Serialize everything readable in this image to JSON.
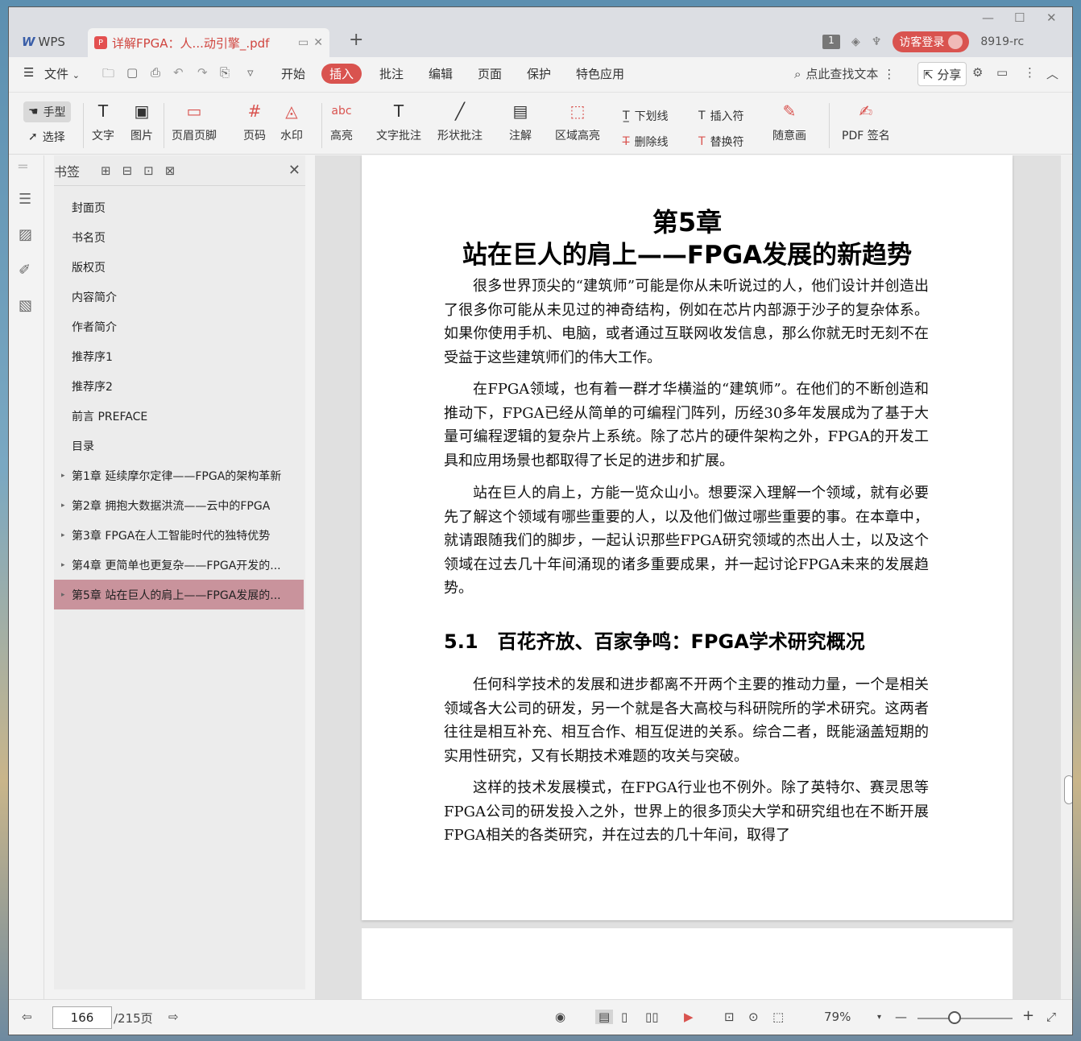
{
  "window": {
    "app_tab": "WPS",
    "doc_tab": "详解FPGA：人...动引擎_.pdf",
    "new_tab_symbol": "+",
    "page_badge": "1",
    "login_label": "访客登录",
    "version": "8919-rc",
    "controls": {
      "minimize": "—",
      "maximize": "☐",
      "close": "✕"
    }
  },
  "menu": {
    "file": "文件",
    "items": [
      "开始",
      "插入",
      "批注",
      "编辑",
      "页面",
      "保护",
      "特色应用"
    ],
    "active": "插入",
    "search": "点此查找文本",
    "share": "分享"
  },
  "toolbar": {
    "hand": "手型",
    "select": "选择",
    "text": "文字",
    "image": "图片",
    "header_footer": "页眉页脚",
    "page_number": "页码",
    "watermark": "水印",
    "highlight": "高亮",
    "text_comment": "文字批注",
    "shape_comment": "形状批注",
    "annotation": "注解",
    "area_highlight": "区域高亮",
    "underline": "下划线",
    "strikethrough": "删除线",
    "insert_mark": "插入符",
    "replace_mark": "替换符",
    "freehand": "随意画",
    "pdf_sign": "PDF 签名"
  },
  "bookmarks": {
    "title": "书签",
    "items": [
      {
        "label": "封面页",
        "expandable": false
      },
      {
        "label": "书名页",
        "expandable": false
      },
      {
        "label": "版权页",
        "expandable": false
      },
      {
        "label": "内容简介",
        "expandable": false
      },
      {
        "label": "作者简介",
        "expandable": false
      },
      {
        "label": "推荐序1",
        "expandable": false
      },
      {
        "label": "推荐序2",
        "expandable": false
      },
      {
        "label": "前言 PREFACE",
        "expandable": false
      },
      {
        "label": "目录",
        "expandable": false
      },
      {
        "label": "第1章 延续摩尔定律——FPGA的架构革新",
        "expandable": true
      },
      {
        "label": "第2章 拥抱大数据洪流——云中的FPGA",
        "expandable": true
      },
      {
        "label": "第3章 FPGA在人工智能时代的独特优势",
        "expandable": true
      },
      {
        "label": "第4章 更简单也更复杂——FPGA开发的...",
        "expandable": true
      },
      {
        "label": "第5章 站在巨人的肩上——FPGA发展的...",
        "expandable": true,
        "selected": true
      }
    ]
  },
  "document": {
    "chapter_number": "第5章",
    "chapter_title": "站在巨人的肩上——FPGA发展的新趋势",
    "paragraphs": [
      "很多世界顶尖的“建筑师”可能是你从未听说过的人，他们设计并创造出了很多你可能从未见过的神奇结构，例如在芯片内部源于沙子的复杂体系。如果你使用手机、电脑，或者通过互联网收发信息，那么你就无时无刻不在受益于这些建筑师们的伟大工作。",
      "在FPGA领域，也有着一群才华横溢的“建筑师”。在他们的不断创造和推动下，FPGA已经从简单的可编程门阵列，历经30多年发展成为了基于大量可编程逻辑的复杂片上系统。除了芯片的硬件架构之外，FPGA的开发工具和应用场景也都取得了长足的进步和扩展。",
      "站在巨人的肩上，方能一览众山小。想要深入理解一个领域，就有必要先了解这个领域有哪些重要的人，以及他们做过哪些重要的事。在本章中，就请跟随我们的脚步，一起认识那些FPGA研究领域的杰出人士，以及这个领域在过去几十年间涌现的诸多重要成果，并一起讨论FPGA未来的发展趋势。"
    ],
    "section_title": "5.1　百花齐放、百家争鸣：FPGA学术研究概况",
    "section_paragraphs": [
      "任何科学技术的发展和进步都离不开两个主要的推动力量，一个是相关领域各大公司的研发，另一个就是各大高校与科研院所的学术研究。这两者往往是相互补充、相互合作、相互促进的关系。综合二者，既能涵盖短期的实用性研究，又有长期技术难题的攻关与突破。",
      "这样的技术发展模式，在FPGA行业也不例外。除了英特尔、赛灵思等FPGA公司的研发投入之外，世界上的很多顶尖大学和研究组也在不断开展FPGA相关的各类研究，并在过去的几十年间，取得了"
    ]
  },
  "status": {
    "current_page": "166",
    "total_pages": "/215页",
    "zoom": "79%"
  },
  "colors": {
    "accent": "#d9534f",
    "selected_bookmark": "#c9939c"
  }
}
